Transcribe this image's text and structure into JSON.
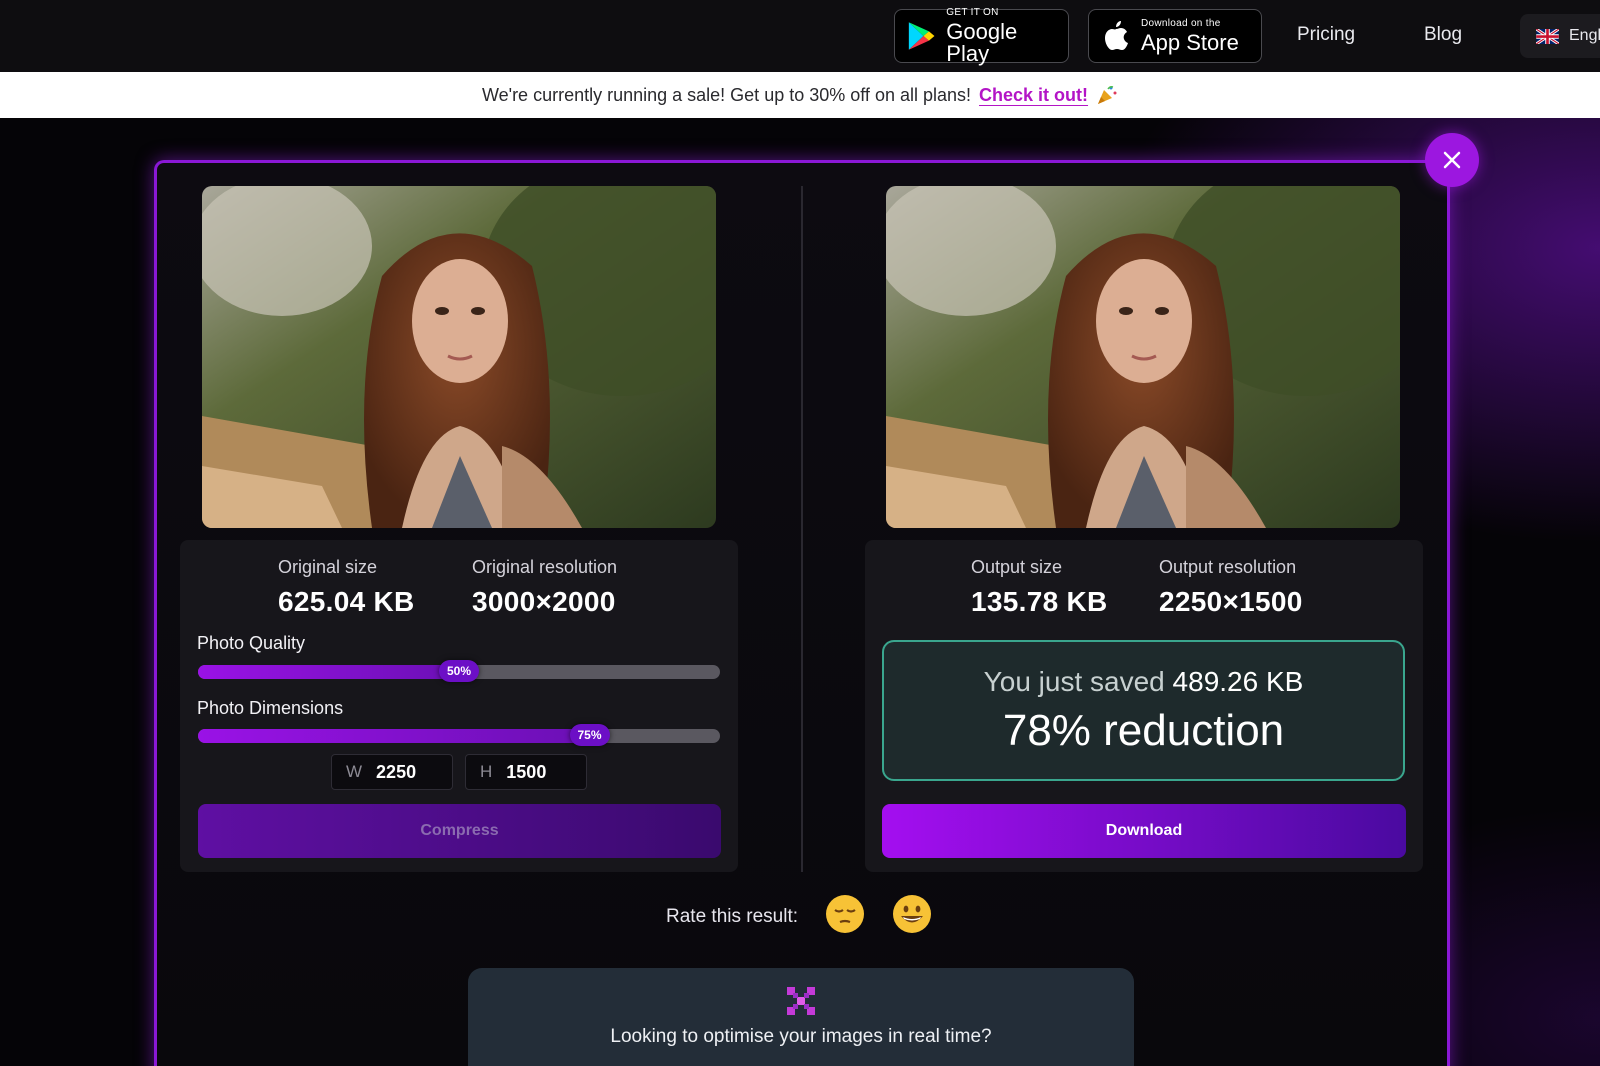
{
  "nav": {
    "google_play": {
      "small": "GET IT ON",
      "big": "Google Play"
    },
    "app_store": {
      "small": "Download on the",
      "big": "App Store"
    },
    "pricing": "Pricing",
    "blog": "Blog",
    "language": "Engl"
  },
  "banner": {
    "text": "We're currently running a sale! Get up to 30% off on all plans!",
    "cta": "Check it out!"
  },
  "original": {
    "size_label": "Original size",
    "size_value": "625.04 KB",
    "resolution_label": "Original resolution",
    "resolution_value": "3000×2000",
    "quality_label": "Photo Quality",
    "quality_value": 0.5,
    "quality_text": "50%",
    "dimensions_label": "Photo Dimensions",
    "dimensions_value": 0.75,
    "dimensions_text": "75%",
    "width_prefix": "W",
    "width_value": "2250",
    "height_prefix": "H",
    "height_value": "1500",
    "compress_label": "Compress"
  },
  "output": {
    "size_label": "Output size",
    "size_value": "135.78 KB",
    "resolution_label": "Output resolution",
    "resolution_value": "2250×1500",
    "saved_prefix": "You just saved",
    "saved_value": "489.26 KB",
    "reduction": "78% reduction",
    "download_label": "Download"
  },
  "rating": {
    "label": "Rate this result:"
  },
  "promo": {
    "text": "Looking to optimise your images in real time?"
  },
  "colors": {
    "accent": "#9c17e0",
    "saved_border": "#3aa68e",
    "cta": "#b314c6"
  }
}
